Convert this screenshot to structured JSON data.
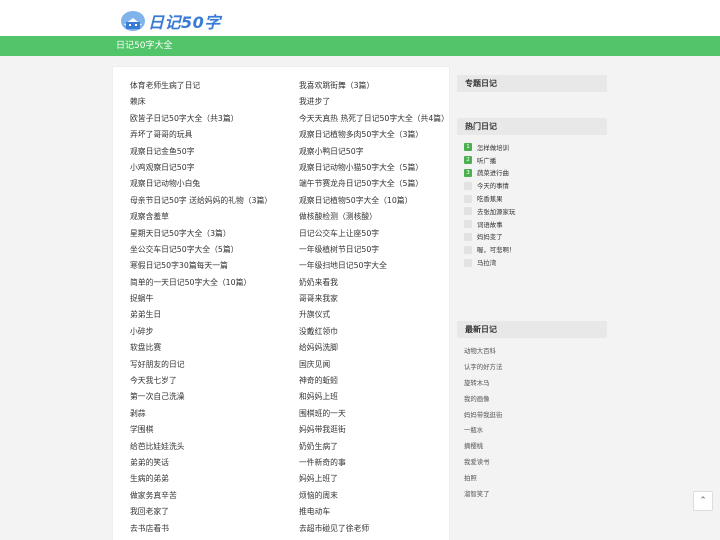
{
  "header": {
    "logo_text": "日记50字"
  },
  "navbar": {
    "title": "日记50字大全"
  },
  "entries_left": [
    "体育老师生病了日记",
    "赖床",
    "欧皆子日记50字大全（共3篇）",
    "弄坏了哥哥的玩具",
    "观察日记金鱼50字",
    "小鸡观察日记50字",
    "观察日记动物小白兔",
    "母亲节日记50字 送给妈妈的礼物（3篇）",
    "观察含羞草",
    "星期天日记50字大全（3篇）",
    "坐公交车日记50字大全（5篇）",
    "寒假日记50字30篇每天一篇",
    "简单的一天日记50字大全（10篇）",
    "捉蜗牛",
    "弟弟生日",
    "小碎步",
    "软盘比赛",
    "写好朋友的日记",
    "今天我七岁了",
    "第一次自己洗澡",
    "剥蒜",
    "学围棋",
    "给芭比娃娃洗头",
    "弟弟的笑话",
    "生病的弟弟",
    "做家务真辛苦",
    "我回老家了",
    "去书店看书"
  ],
  "entries_right": [
    "我喜欢跳街舞（3篇）",
    "我进步了",
    "今天天真热 热死了日记50字大全（共4篇）",
    "观察日记植物多肉50字大全（3篇）",
    "观察小鸭日记50字",
    "观察日记动物小猫50字大全（5篇）",
    "端午节赛龙舟日记50字大全（5篇）",
    "观察日记植物50字大全（10篇）",
    "做核酸检测（测核酸）",
    "日记公交车上让座50字",
    "一年级植树节日记50字",
    "一年级扫地日记50字大全",
    "奶奶来看我",
    "哥哥来我家",
    "升旗仪式",
    "没戴红领巾",
    "给妈妈洗脚",
    "国庆见闻",
    "神奇的蚯蚓",
    "和妈妈上班",
    "围棋班的一天",
    "妈妈带我逛街",
    "奶奶生病了",
    "一件新奇的事",
    "妈妈上班了",
    "烦恼的周末",
    "推电动车",
    "去超市碰见了徐老师"
  ],
  "sidebar": {
    "topic_title": "专题日记",
    "hot_title": "热门日记",
    "hot_items": [
      {
        "rank": "1",
        "label": "怎样做培训"
      },
      {
        "rank": "2",
        "label": "听广播"
      },
      {
        "rank": "3",
        "label": "蔬菜进行曲"
      },
      {
        "rank": "4",
        "label": "今天的事情"
      },
      {
        "rank": "5",
        "label": "吃香蕉果"
      },
      {
        "rank": "6",
        "label": "去张加源家玩"
      },
      {
        "rank": "7",
        "label": "词语故事"
      },
      {
        "rank": "8",
        "label": "妈妈变了"
      },
      {
        "rank": "9",
        "label": "喔，可悲啊！"
      },
      {
        "rank": "10",
        "label": "马拉湾"
      }
    ],
    "new_title": "最新日记",
    "new_items": [
      "动物大百科",
      "认字的好方法",
      "旋转木马",
      "我的画像",
      "妈妈带我逛街",
      "一瓶水",
      "摘樱桃",
      "我爱读书",
      "拍照",
      "溜智笑了"
    ]
  },
  "back_top_icon": "chevron-up-icon",
  "colors": {
    "nav_green": "#52c46a",
    "rank_green": "#4caf50",
    "logo_blue": "#3a7bd5"
  }
}
